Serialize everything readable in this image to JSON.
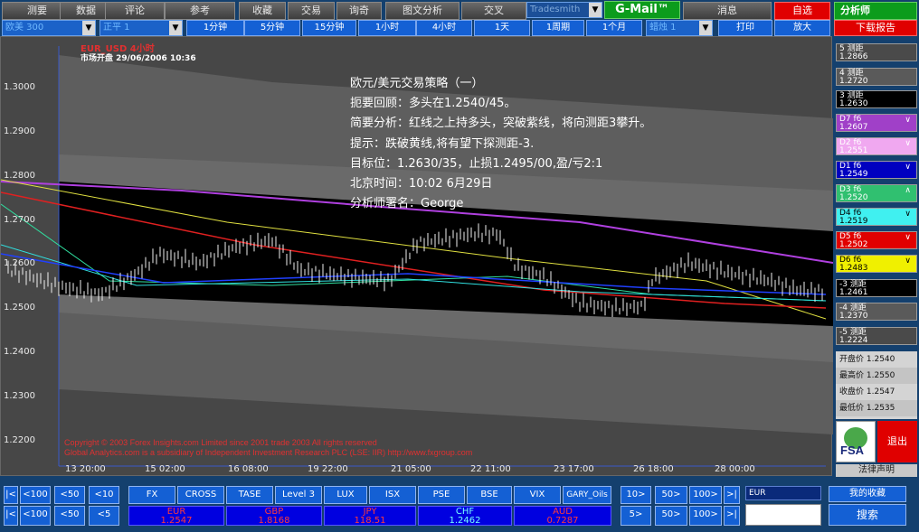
{
  "top_menu": [
    "测要",
    "数据",
    "评论",
    "参考",
    "收藏",
    "交易",
    "询奇",
    "图文分析",
    "交叉"
  ],
  "search_box": "Tradesmith",
  "gmail_label": "G-Mail™",
  "top_right": {
    "btn1": "消息",
    "btn2": "自选",
    "title": "分析师"
  },
  "symbol_select": "欧美 300",
  "type_select": "正平 1",
  "timeframes": [
    "1分钟",
    "5分钟",
    "15分钟",
    "1小时",
    "4小时",
    "1天",
    "1周期",
    "1个月"
  ],
  "period_select": "蜡烛 1",
  "print_label": "打印",
  "zoom_label": "放大",
  "download_label": "下载报告",
  "chart_header": {
    "pair": "EUR_USD 4小时",
    "market_line": "市场开盘 29/06/2006 10:36"
  },
  "annotation": [
    "欧元/美元交易策略（一）",
    "扼要回顾：多头在1.2540/45。",
    "简要分析：红线之上持多头，突破紫线，将向测距3攀升。",
    "提示：跌破黄线,将有望下探测距-3.",
    "目标位：1.2630/35，止损1.2495/00,盈/亏2:1",
    "北京时间：10:02    6月29日",
    "分析师署名：George"
  ],
  "y_ticks": [
    "1.3000",
    "1.2900",
    "1.2800",
    "1.2700",
    "1.2600",
    "1.2500",
    "1.2400",
    "1.2300",
    "1.2200"
  ],
  "x_ticks": [
    "13 20:00",
    "15 02:00",
    "16 08:00",
    "19 22:00",
    "21 05:00",
    "22 11:00",
    "23 17:00",
    "26 18:00",
    "28 00:00"
  ],
  "copyright": [
    "Copyright © 2003 Forex Insights.com Limited since 2001 trade 2003 All rights reserved",
    "Global Analytics.com is a subsidiary of Independent Investment Research PLC (LSE: IIR) http://www.fxgroup.com"
  ],
  "right_panel": [
    {
      "label": "5 测距",
      "value": "1.2866"
    },
    {
      "label": "4 测距",
      "value": "1.2720"
    },
    {
      "label": "3 测距",
      "value": "1.2630"
    },
    {
      "label": "D7 f6",
      "value": "1.2607"
    },
    {
      "label": "D2 f6",
      "value": "1.2551"
    },
    {
      "label": "D1 f6",
      "value": "1.2549"
    },
    {
      "label": "D3 f6",
      "value": "1.2520"
    },
    {
      "label": "D4 f6",
      "value": "1.2519"
    },
    {
      "label": "D5 f6",
      "value": "1.2502"
    },
    {
      "label": "D6 f6",
      "value": "1.2483"
    },
    {
      "label": "-3 测距",
      "value": "1.2461"
    },
    {
      "label": "-4 测距",
      "value": "1.2370"
    },
    {
      "label": "-5 测距",
      "value": "1.2224"
    }
  ],
  "stats": [
    {
      "label": "开盘价",
      "value": "1.2540"
    },
    {
      "label": "最高价",
      "value": "1.2550"
    },
    {
      "label": "收盘价",
      "value": "1.2547"
    },
    {
      "label": "最低价",
      "value": "1.2535"
    }
  ],
  "fsa_label": "FSA",
  "exit_label": "退出",
  "disclaimer_label": "法律声明",
  "nav_left_top": [
    "|<",
    "<100",
    "<50",
    "<10"
  ],
  "nav_left_bottom": [
    "|<",
    "<100",
    "<50",
    "<5"
  ],
  "instruments": [
    "FX",
    "CROSS",
    "TASE",
    "Level 3",
    "LUX",
    "ISX",
    "PSE",
    "BSE",
    "VIX",
    "GARY_Oils"
  ],
  "quotes": [
    {
      "name": "EUR",
      "value": "1.2547",
      "color": "red"
    },
    {
      "name": "GBP",
      "value": "1.8168",
      "color": "red"
    },
    {
      "name": "JPY",
      "value": "118.51",
      "color": "red"
    },
    {
      "name": "CHF",
      "value": "1.2462",
      "color": "cyan"
    },
    {
      "name": "AUD",
      "value": "0.7287",
      "color": "red"
    }
  ],
  "nav_right_top": [
    "10>",
    "50>",
    "100>",
    ">|"
  ],
  "nav_right_bottom": [
    "5>",
    "50>",
    "100>",
    ">|"
  ],
  "symbol_field": "EUR",
  "favorites_label": "我的收藏",
  "search_label": "搜索"
}
